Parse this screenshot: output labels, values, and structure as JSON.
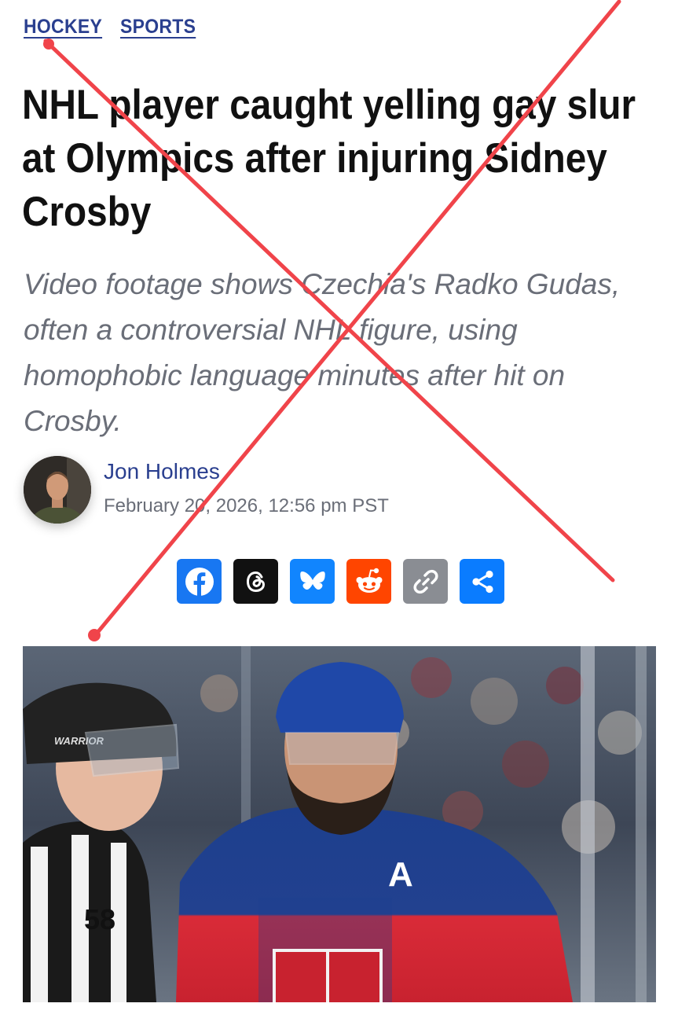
{
  "tags": [
    "HOCKEY",
    "SPORTS"
  ],
  "headline": "NHL player caught yelling gay slur at Olympics after injuring Sidney Crosby",
  "dek": "Video footage shows Czechia's Radko Gudas, often a controversial NHL figure, using homophobic language minutes after hit on Crosby.",
  "author": {
    "name": "Jon Holmes",
    "date": "February 20, 2026, 12:56 pm PST"
  },
  "share_buttons": [
    {
      "name": "facebook",
      "icon": "facebook-icon",
      "color": "#1877f2"
    },
    {
      "name": "threads",
      "icon": "threads-icon",
      "color": "#111111"
    },
    {
      "name": "bluesky",
      "icon": "bluesky-icon",
      "color": "#1185fe"
    },
    {
      "name": "reddit",
      "icon": "reddit-icon",
      "color": "#ff4500"
    },
    {
      "name": "copy-link",
      "icon": "link-icon",
      "color": "#8a8d93"
    },
    {
      "name": "share",
      "icon": "share-icon",
      "color": "#0a7cff"
    }
  ],
  "photo": {
    "referee_number": "58",
    "helmet_brand": "WARRIOR",
    "captain_letter": "A"
  },
  "overlay": {
    "type": "red-x-mark",
    "color": "#f0444a"
  },
  "colors": {
    "link": "#2a3f8f",
    "headline": "#111111",
    "dek": "#6a6e78"
  }
}
